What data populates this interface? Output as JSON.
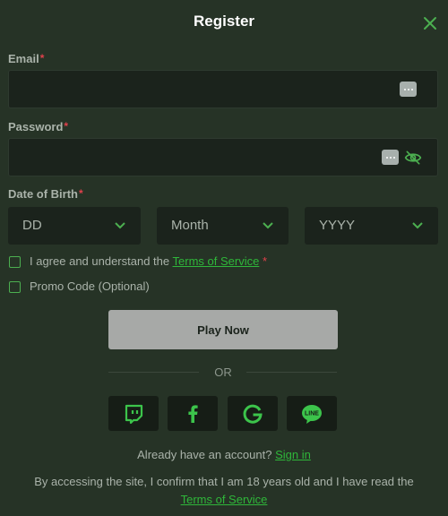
{
  "header": {
    "title": "Register"
  },
  "email": {
    "label": "Email",
    "required_mark": "*",
    "value": ""
  },
  "password": {
    "label": "Password",
    "required_mark": "*",
    "value": ""
  },
  "dob": {
    "label": "Date of Birth",
    "required_mark": "*",
    "day_placeholder": "DD",
    "month_placeholder": "Month",
    "year_placeholder": "YYYY"
  },
  "terms_check": {
    "text": "I agree and understand the",
    "link": "Terms of Service",
    "required_mark": "*",
    "checked": false
  },
  "promo_check": {
    "text": "Promo Code (Optional)",
    "checked": false
  },
  "play_button": {
    "label": "Play Now"
  },
  "divider": {
    "text": "OR"
  },
  "social": [
    "twitch-icon",
    "facebook-icon",
    "google-icon",
    "line-icon"
  ],
  "signin": {
    "text": "Already have an account?",
    "link": "Sign in"
  },
  "legal": {
    "text": "By accessing the site, I confirm that I am 18 years old and I have read the",
    "link": "Terms of Service"
  },
  "colors": {
    "background": "#263326",
    "input_bg": "#1b231c",
    "accent_green": "#2fb73a",
    "required_red": "#e0414b",
    "button_gray": "#a7a9a7"
  }
}
